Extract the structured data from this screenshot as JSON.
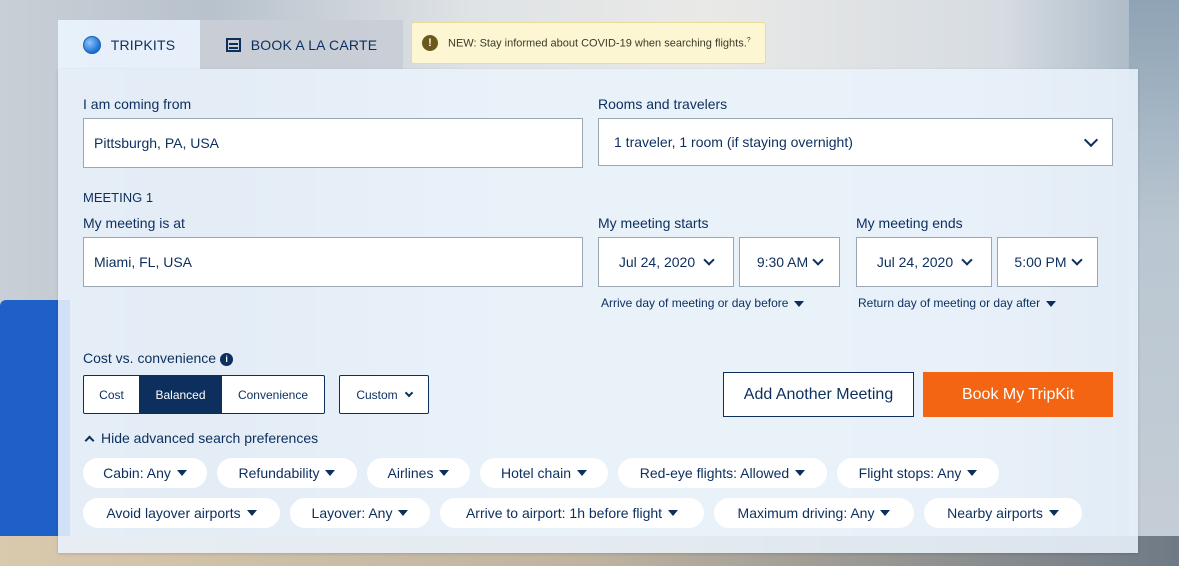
{
  "tabs": [
    {
      "label": "TRIPKITS",
      "icon": "globe-icon",
      "active": true
    },
    {
      "label": "BOOK A LA CARTE",
      "icon": "list-icon",
      "active": false
    }
  ],
  "notice": {
    "text": "NEW: Stay informed about COVID-19 when searching flights.",
    "sup": "?"
  },
  "origin": {
    "label": "I am coming from",
    "value": "Pittsburgh, PA, USA"
  },
  "rooms": {
    "label": "Rooms and travelers",
    "value": "1 traveler, 1 room (if staying overnight)"
  },
  "meeting": {
    "heading": "MEETING 1",
    "location_label": "My meeting is at",
    "location_value": "Miami, FL, USA",
    "starts_label": "My meeting starts",
    "start_date": "Jul 24, 2020",
    "start_time": "9:30 AM",
    "start_hint": "Arrive day of meeting or day before",
    "ends_label": "My meeting ends",
    "end_date": "Jul 24, 2020",
    "end_time": "5:00 PM",
    "end_hint": "Return day of meeting or day after"
  },
  "cost": {
    "label": "Cost vs. convenience",
    "options": [
      "Cost",
      "Balanced",
      "Convenience"
    ],
    "selected": "Balanced",
    "custom_label": "Custom"
  },
  "actions": {
    "add_meeting": "Add Another Meeting",
    "book": "Book My TripKit"
  },
  "advanced": {
    "toggle_label": "Hide advanced search preferences",
    "chips_row1": [
      "Cabin: Any",
      "Refundability",
      "Airlines",
      "Hotel chain",
      "Red-eye flights: Allowed",
      "Flight stops: Any"
    ],
    "chips_row2": [
      "Avoid layover airports",
      "Layover: Any",
      "Arrive to airport: 1h before flight",
      "Maximum driving: Any",
      "Nearby airports"
    ]
  },
  "colors": {
    "navy": "#0c2f5e",
    "orange": "#f36513",
    "notice_bg": "#fdf6d3"
  }
}
